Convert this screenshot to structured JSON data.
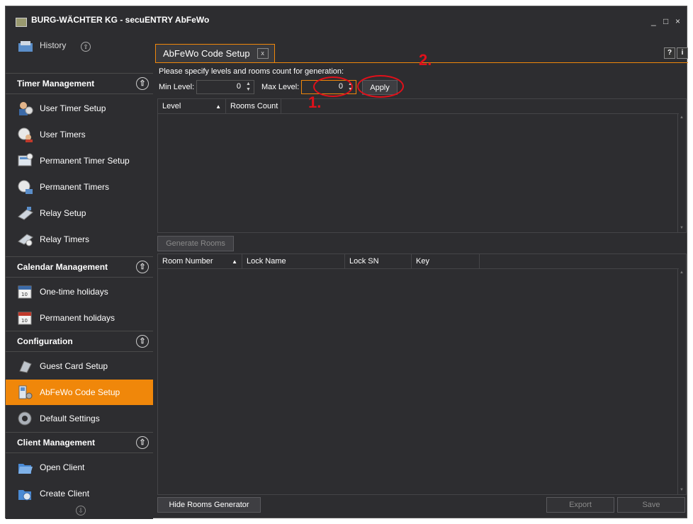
{
  "window": {
    "title": "BURG-WÄCHTER KG - secuENTRY AbFeWo",
    "controls": {
      "minimize": "_",
      "maximize": "□",
      "close": "×"
    }
  },
  "sidebar": {
    "top_item": "History",
    "scroll_up": "⇧",
    "scroll_down": "⇩",
    "sections": [
      {
        "title": "Timer Management",
        "toggle": "⇧",
        "items": [
          "User Timer Setup",
          "User Timers",
          "Permanent Timer Setup",
          "Permanent Timers",
          "Relay Setup",
          "Relay Timers"
        ]
      },
      {
        "title": "Calendar Management",
        "toggle": "⇧",
        "items": [
          "One-time holidays",
          "Permanent holidays"
        ]
      },
      {
        "title": "Configuration",
        "toggle": "⇧",
        "items": [
          "Guest Card Setup",
          "AbFeWo Code Setup",
          "Default Settings"
        ]
      },
      {
        "title": "Client Management",
        "toggle": "⇧",
        "items": [
          "Open Client",
          "Create Client"
        ]
      }
    ],
    "active_item": "AbFeWo Code Setup",
    "accent_color": "#f0870a"
  },
  "main": {
    "tab": {
      "label": "AbFeWo Code Setup",
      "close": "x"
    },
    "help_buttons": [
      "?",
      "i"
    ],
    "prompt": "Please specify levels and rooms count for generation:",
    "min_level": {
      "label": "Min Level:",
      "value": "0"
    },
    "max_level": {
      "label": "Max Level:",
      "value": "0"
    },
    "apply_label": "Apply",
    "levels_grid": {
      "columns": [
        "Level",
        "Rooms Count"
      ]
    },
    "generate_rooms_label": "Generate Rooms",
    "rooms_grid": {
      "columns": [
        "Room Number",
        "Lock Name",
        "Lock SN",
        "Key"
      ]
    },
    "hide_generator_label": "Hide Rooms Generator",
    "export_label": "Export",
    "save_label": "Save"
  },
  "annotations": {
    "step1": "1.",
    "step2": "2.",
    "color": "#e0101a"
  }
}
